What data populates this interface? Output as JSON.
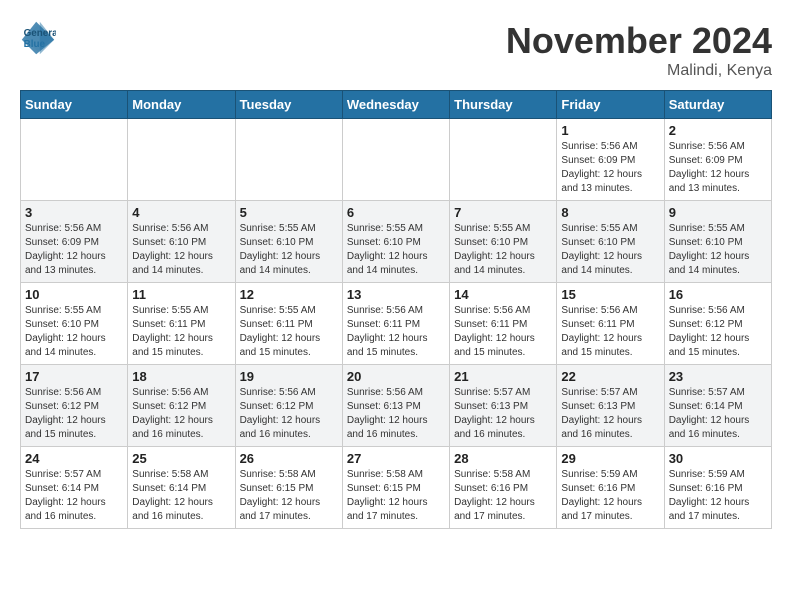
{
  "logo": {
    "line1": "General",
    "line2": "Blue"
  },
  "title": "November 2024",
  "location": "Malindi, Kenya",
  "days_of_week": [
    "Sunday",
    "Monday",
    "Tuesday",
    "Wednesday",
    "Thursday",
    "Friday",
    "Saturday"
  ],
  "weeks": [
    [
      {
        "day": "",
        "info": ""
      },
      {
        "day": "",
        "info": ""
      },
      {
        "day": "",
        "info": ""
      },
      {
        "day": "",
        "info": ""
      },
      {
        "day": "",
        "info": ""
      },
      {
        "day": "1",
        "info": "Sunrise: 5:56 AM\nSunset: 6:09 PM\nDaylight: 12 hours\nand 13 minutes."
      },
      {
        "day": "2",
        "info": "Sunrise: 5:56 AM\nSunset: 6:09 PM\nDaylight: 12 hours\nand 13 minutes."
      }
    ],
    [
      {
        "day": "3",
        "info": "Sunrise: 5:56 AM\nSunset: 6:09 PM\nDaylight: 12 hours\nand 13 minutes."
      },
      {
        "day": "4",
        "info": "Sunrise: 5:56 AM\nSunset: 6:10 PM\nDaylight: 12 hours\nand 14 minutes."
      },
      {
        "day": "5",
        "info": "Sunrise: 5:55 AM\nSunset: 6:10 PM\nDaylight: 12 hours\nand 14 minutes."
      },
      {
        "day": "6",
        "info": "Sunrise: 5:55 AM\nSunset: 6:10 PM\nDaylight: 12 hours\nand 14 minutes."
      },
      {
        "day": "7",
        "info": "Sunrise: 5:55 AM\nSunset: 6:10 PM\nDaylight: 12 hours\nand 14 minutes."
      },
      {
        "day": "8",
        "info": "Sunrise: 5:55 AM\nSunset: 6:10 PM\nDaylight: 12 hours\nand 14 minutes."
      },
      {
        "day": "9",
        "info": "Sunrise: 5:55 AM\nSunset: 6:10 PM\nDaylight: 12 hours\nand 14 minutes."
      }
    ],
    [
      {
        "day": "10",
        "info": "Sunrise: 5:55 AM\nSunset: 6:10 PM\nDaylight: 12 hours\nand 14 minutes."
      },
      {
        "day": "11",
        "info": "Sunrise: 5:55 AM\nSunset: 6:11 PM\nDaylight: 12 hours\nand 15 minutes."
      },
      {
        "day": "12",
        "info": "Sunrise: 5:55 AM\nSunset: 6:11 PM\nDaylight: 12 hours\nand 15 minutes."
      },
      {
        "day": "13",
        "info": "Sunrise: 5:56 AM\nSunset: 6:11 PM\nDaylight: 12 hours\nand 15 minutes."
      },
      {
        "day": "14",
        "info": "Sunrise: 5:56 AM\nSunset: 6:11 PM\nDaylight: 12 hours\nand 15 minutes."
      },
      {
        "day": "15",
        "info": "Sunrise: 5:56 AM\nSunset: 6:11 PM\nDaylight: 12 hours\nand 15 minutes."
      },
      {
        "day": "16",
        "info": "Sunrise: 5:56 AM\nSunset: 6:12 PM\nDaylight: 12 hours\nand 15 minutes."
      }
    ],
    [
      {
        "day": "17",
        "info": "Sunrise: 5:56 AM\nSunset: 6:12 PM\nDaylight: 12 hours\nand 15 minutes."
      },
      {
        "day": "18",
        "info": "Sunrise: 5:56 AM\nSunset: 6:12 PM\nDaylight: 12 hours\nand 16 minutes."
      },
      {
        "day": "19",
        "info": "Sunrise: 5:56 AM\nSunset: 6:12 PM\nDaylight: 12 hours\nand 16 minutes."
      },
      {
        "day": "20",
        "info": "Sunrise: 5:56 AM\nSunset: 6:13 PM\nDaylight: 12 hours\nand 16 minutes."
      },
      {
        "day": "21",
        "info": "Sunrise: 5:57 AM\nSunset: 6:13 PM\nDaylight: 12 hours\nand 16 minutes."
      },
      {
        "day": "22",
        "info": "Sunrise: 5:57 AM\nSunset: 6:13 PM\nDaylight: 12 hours\nand 16 minutes."
      },
      {
        "day": "23",
        "info": "Sunrise: 5:57 AM\nSunset: 6:14 PM\nDaylight: 12 hours\nand 16 minutes."
      }
    ],
    [
      {
        "day": "24",
        "info": "Sunrise: 5:57 AM\nSunset: 6:14 PM\nDaylight: 12 hours\nand 16 minutes."
      },
      {
        "day": "25",
        "info": "Sunrise: 5:58 AM\nSunset: 6:14 PM\nDaylight: 12 hours\nand 16 minutes."
      },
      {
        "day": "26",
        "info": "Sunrise: 5:58 AM\nSunset: 6:15 PM\nDaylight: 12 hours\nand 17 minutes."
      },
      {
        "day": "27",
        "info": "Sunrise: 5:58 AM\nSunset: 6:15 PM\nDaylight: 12 hours\nand 17 minutes."
      },
      {
        "day": "28",
        "info": "Sunrise: 5:58 AM\nSunset: 6:16 PM\nDaylight: 12 hours\nand 17 minutes."
      },
      {
        "day": "29",
        "info": "Sunrise: 5:59 AM\nSunset: 6:16 PM\nDaylight: 12 hours\nand 17 minutes."
      },
      {
        "day": "30",
        "info": "Sunrise: 5:59 AM\nSunset: 6:16 PM\nDaylight: 12 hours\nand 17 minutes."
      }
    ]
  ]
}
